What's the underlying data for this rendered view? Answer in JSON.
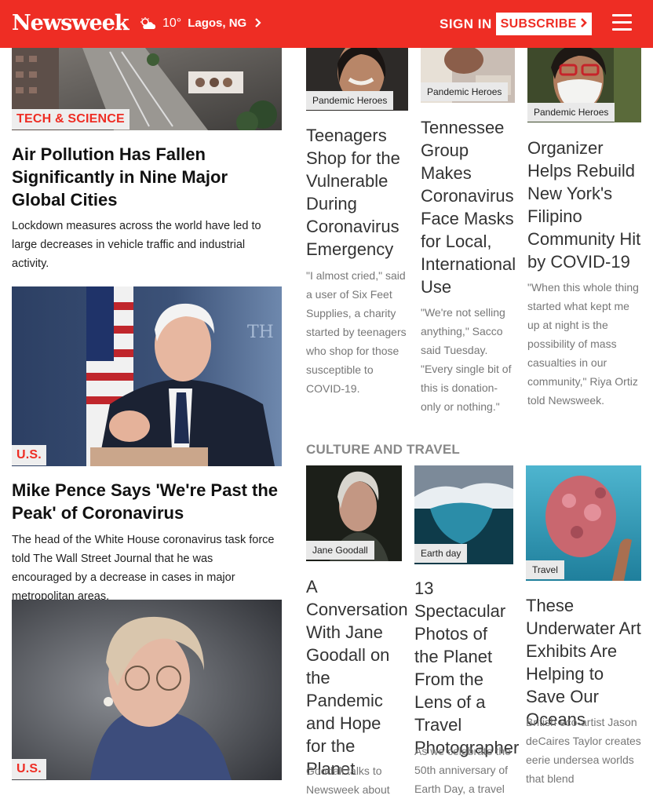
{
  "header": {
    "logo": "Newsweek",
    "weather_icon": "partly-cloudy-icon",
    "temperature": "10°",
    "location": "Lagos, NG",
    "signin": "SIGN IN",
    "subscribe": "SUBSCRIBE",
    "menu_icon": "hamburger-menu-icon",
    "brand_color": "#ee2d24"
  },
  "left_articles": [
    {
      "tag": "TECH & SCIENCE",
      "title": "Air Pollution Has Fallen Significantly in Nine Major Global Cities",
      "summary": "Lockdown measures across the world have led to large decreases in vehicle traffic and industrial activity."
    },
    {
      "tag": "U.S.",
      "title": "Mike Pence Says 'We're Past the Peak' of Coronavirus",
      "summary": "The head of the White House coronavirus task force told The Wall Street Journal that he was encouraged by a decrease in cases in major metropolitan areas."
    },
    {
      "tag": "U.S."
    }
  ],
  "heroes": [
    {
      "tag": "Pandemic Heroes",
      "title": "Teenagers Shop for the Vulnerable During Coronavirus Emergency",
      "summary": "\"I almost cried,\" said a user of Six Feet Supplies, a charity started by teenagers who shop for those susceptible to COVID-19."
    },
    {
      "tag": "Pandemic Heroes",
      "title": "Tennessee Group Makes Coronavirus Face Masks for Local, International Use",
      "summary": "\"We're not selling anything,\" Sacco said Tuesday. \"Every single bit of this is donation-only or nothing.\""
    },
    {
      "tag": "Pandemic Heroes",
      "title": "Organizer Helps Rebuild New York's Filipino Community Hit by COVID-19",
      "summary": "\"When this whole thing started what kept me up at night is the possibility of mass casualties in our community,\" Riya Ortiz told Newsweek."
    }
  ],
  "culture": {
    "section_title": "CULTURE AND TRAVEL",
    "articles": [
      {
        "tag": "Jane Goodall",
        "title": "A Conversation With Jane Goodall on the Pandemic and Hope for the Planet",
        "summary": "Goodall talks to Newsweek about"
      },
      {
        "tag": "Earth day",
        "title": "13 Spectacular Photos of the Planet From the Lens of a Travel Photographer",
        "summary": "As we celebrate the 50th anniversary of Earth Day, a travel"
      },
      {
        "tag": "Travel",
        "title": "These Underwater Art Exhibits Are Helping to Save Our Oceans",
        "summary": "British eco-artist Jason deCaires Taylor creates eerie undersea worlds that blend"
      }
    ]
  }
}
